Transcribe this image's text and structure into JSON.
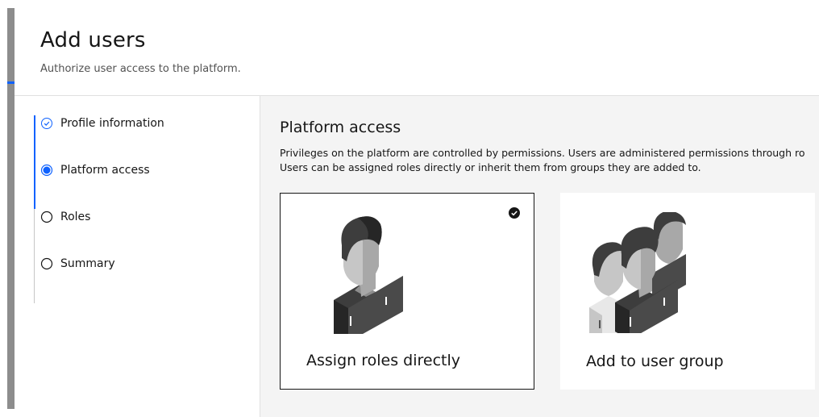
{
  "header": {
    "title": "Add users",
    "subtitle": "Authorize user access to the platform."
  },
  "steps": [
    {
      "label": "Profile information",
      "state": "complete"
    },
    {
      "label": "Platform access",
      "state": "current"
    },
    {
      "label": "Roles",
      "state": "incomplete"
    },
    {
      "label": "Summary",
      "state": "incomplete"
    }
  ],
  "main": {
    "title": "Platform access",
    "description_line1": "Privileges on the platform are controlled by permissions. Users are administered permissions through ro",
    "description_line2": "Users can be assigned roles directly or inherit them from groups they are added to.",
    "tiles": [
      {
        "label": "Assign roles directly",
        "selected": true,
        "icon": "single-user-icon"
      },
      {
        "label": "Add to user group",
        "selected": false,
        "icon": "user-group-icon"
      }
    ]
  },
  "colors": {
    "accent": "#0f62fe",
    "background": "#f4f4f4",
    "text": "#161616"
  }
}
